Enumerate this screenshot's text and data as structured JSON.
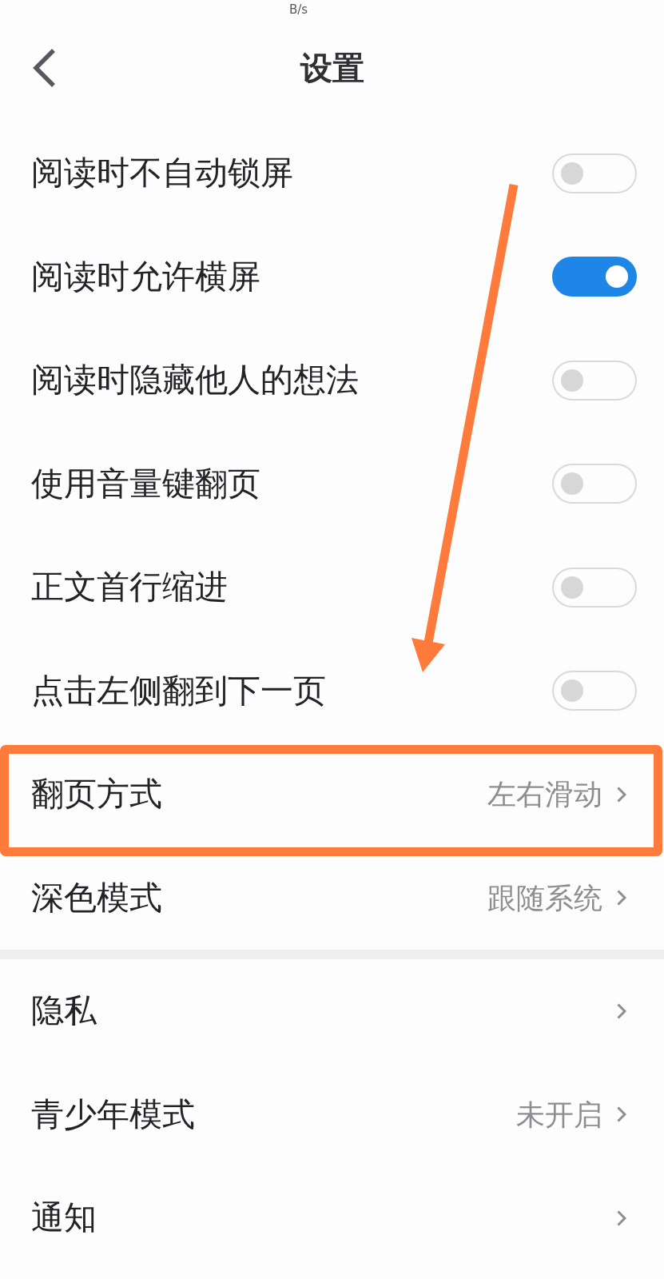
{
  "status_bar": {
    "speed_unit": "B/s"
  },
  "header": {
    "title": "设置"
  },
  "sections": [
    {
      "items": [
        {
          "kind": "toggle",
          "label": "阅读时不自动锁屏",
          "on": false,
          "highlighted": false
        },
        {
          "kind": "toggle",
          "label": "阅读时允许横屏",
          "on": true,
          "highlighted": false
        },
        {
          "kind": "toggle",
          "label": "阅读时隐藏他人的想法",
          "on": false,
          "highlighted": false
        },
        {
          "kind": "toggle",
          "label": "使用音量键翻页",
          "on": false,
          "highlighted": false
        },
        {
          "kind": "toggle",
          "label": "正文首行缩进",
          "on": false,
          "highlighted": false
        },
        {
          "kind": "toggle",
          "label": "点击左侧翻到下一页",
          "on": false,
          "highlighted": false
        },
        {
          "kind": "link",
          "label": "翻页方式",
          "value": "左右滑动",
          "highlighted": true
        },
        {
          "kind": "link",
          "label": "深色模式",
          "value": "跟随系统",
          "highlighted": false
        }
      ]
    },
    {
      "items": [
        {
          "kind": "link",
          "label": "隐私",
          "highlighted": false
        },
        {
          "kind": "link",
          "label": "青少年模式",
          "value": "未开启",
          "highlighted": false
        },
        {
          "kind": "link",
          "label": "通知",
          "highlighted": false
        }
      ]
    }
  ]
}
